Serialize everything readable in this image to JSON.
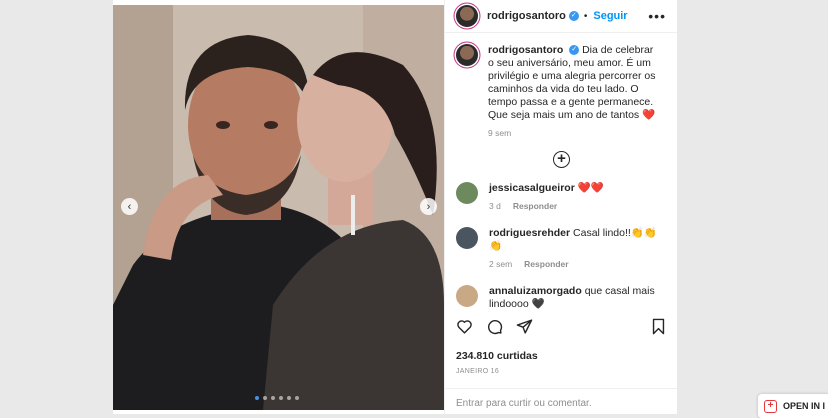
{
  "post": {
    "author": "rodrigosantoro",
    "follow_label": "Seguir",
    "more_label": "•••",
    "caption": "Dia de celebrar o seu aniversário, meu amor. É um privilégio e uma alegria percorrer os caminhos da vida do teu lado. O tempo passa e a gente permanece. Que seja mais um ano de tantos ❤️",
    "caption_time": "9 sem",
    "likes": "234.810 curtidas",
    "date": "JANEIRO 16",
    "comment_placeholder": "Entrar para curtir ou comentar."
  },
  "carousel": {
    "prev_label": "‹",
    "next_label": "›",
    "dot_count": 6,
    "active_dot": 0
  },
  "comments": [
    {
      "user": "jessicasalgueiror",
      "text": "❤️❤️",
      "time": "3 d",
      "reply": "Responder",
      "avatar_color": "#6c8a5e"
    },
    {
      "user": "rodriguesrehder",
      "text": "Casal lindo!!👏👏👏",
      "time": "2 sem",
      "reply": "Responder",
      "avatar_color": "#4a5560"
    },
    {
      "user": "annaluizamorgado",
      "text": "que casal mais lindoooo 🖤",
      "time": "",
      "reply": "",
      "avatar_color": "#c9a985"
    }
  ],
  "icons": {
    "like": "heart-icon",
    "comment": "comment-icon",
    "share": "share-icon",
    "save": "bookmark-icon",
    "load_more": "plus-circle-icon"
  },
  "colors": {
    "link_blue": "#0095f6",
    "verified_blue": "#3897f0",
    "heart_red": "#ed4956",
    "muted": "#8e8e8e"
  },
  "extension_banner": {
    "label": "OPEN IN I"
  }
}
